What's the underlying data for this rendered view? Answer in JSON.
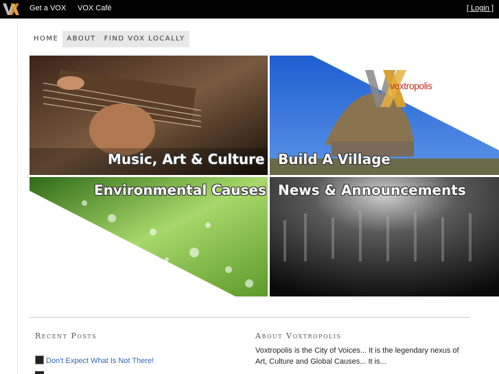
{
  "topbar": {
    "logo": "VX",
    "links": [
      "Get a VOX",
      "VOX Café"
    ],
    "login": "[ Login ]"
  },
  "nav": {
    "items": [
      "HOME",
      "ABOUT",
      "FIND VOX LOCALLY"
    ]
  },
  "tiles": {
    "music": "Music, Art & Culture",
    "village": "Build A Village",
    "environment": "Environmental Causes",
    "news": "News & Announcements",
    "brand_logo": "voxtropolis"
  },
  "recent_posts": {
    "title": "Recent Posts",
    "items": [
      "Don't Expect What Is Not There!"
    ]
  },
  "about": {
    "title": "About Voxtropolis",
    "text": "Voxtropolis is the City of Voices... It is the legendary nexus of Art, Culture and Global Causes... It is..."
  },
  "colors": {
    "topbar": "#000000",
    "link": "#3366aa",
    "logo_orange": "#e8a030",
    "logo_gray": "#888888",
    "sky": "#2f70d8"
  }
}
